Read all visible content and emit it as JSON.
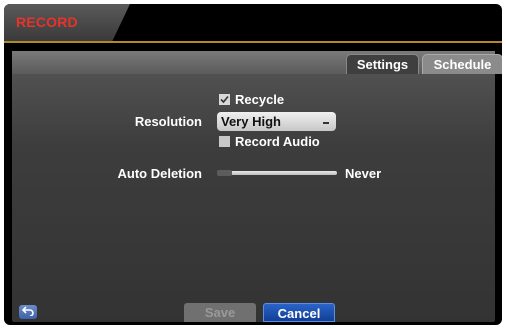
{
  "window": {
    "title": "RECORD"
  },
  "tabs": [
    {
      "label": "Settings",
      "selected": true
    },
    {
      "label": "Schedule",
      "selected": false
    }
  ],
  "settings": {
    "recycle": {
      "label": "Recycle",
      "checked": true
    },
    "resolution": {
      "label": "Resolution",
      "value": "Very High"
    },
    "record_audio": {
      "label": "Record Audio",
      "checked": false
    },
    "auto_deletion": {
      "label": "Auto Deletion",
      "value": "Never"
    }
  },
  "buttons": {
    "save": "Save",
    "cancel": "Cancel"
  },
  "colors": {
    "title_red": "#e8322a",
    "accent_gold": "#b08a28",
    "cancel_blue": "#1f54b5"
  },
  "icons": {
    "back": "back-arrow-icon",
    "checkbox_checked": "checkmark-icon"
  }
}
